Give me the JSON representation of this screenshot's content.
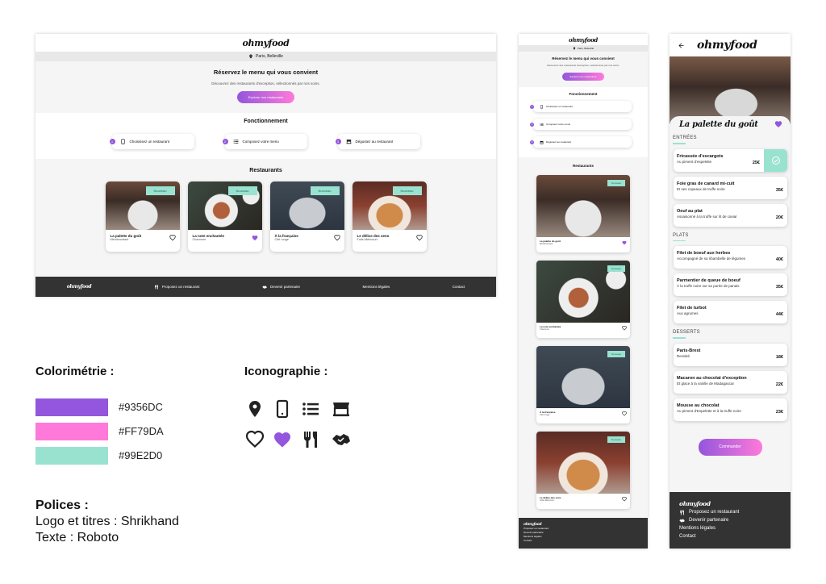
{
  "brand": "ohmyfood",
  "location": "Paris, Belleville",
  "hero": {
    "title": "Réservez le menu qui vous convient",
    "subtitle": "Découvrez des restaurants d'exception, sélectionnés par nos soins.",
    "cta": "Explorer nos restaurants"
  },
  "how": {
    "title": "Fonctionnement",
    "steps": [
      {
        "num": "1",
        "icon": "phone-icon",
        "label": "Choisissez un restaurant"
      },
      {
        "num": "2",
        "icon": "list-icon",
        "label": "Composez votre menu"
      },
      {
        "num": "3",
        "icon": "store-icon",
        "label": "Dégustez au restaurant"
      }
    ]
  },
  "restaurants": {
    "title": "Restaurants",
    "badge": "Nouveau",
    "items": [
      {
        "name": "La palette du goût",
        "area": "Ménilmontant",
        "liked": false
      },
      {
        "name": "La note enchantée",
        "area": "Charonne",
        "liked": true
      },
      {
        "name": "À la française",
        "area": "Cité rouge",
        "liked": false
      },
      {
        "name": "Le délice des sens",
        "area": "Folie-Méricourt",
        "liked": false
      }
    ]
  },
  "footer": {
    "propose": "Proposez un restaurant",
    "partner": "Devenir partenaire",
    "legal": "Mentions légales",
    "contact": "Contact"
  },
  "menu_page": {
    "restaurant": "La palette du goût",
    "sections": [
      {
        "title": "ENTRÉES",
        "dishes": [
          {
            "name": "Fricassée d'escargots",
            "desc": "Au piment d'espelette",
            "price": "25€",
            "selected": true
          },
          {
            "name": "Foie gras de canard mi-cuit",
            "desc": "Et ses copeaux de truffe noire",
            "price": "35€"
          },
          {
            "name": "Oeuf au plat",
            "desc": "Assaisonné à la truffe sur lit de caviar",
            "price": "20€"
          }
        ]
      },
      {
        "title": "PLATS",
        "dishes": [
          {
            "name": "Filet de boeuf aux herbes",
            "desc": "Accompagné de sa ribambelle de légumes",
            "price": "40€"
          },
          {
            "name": "Parmentier de queue de boeuf",
            "desc": "À la truffe noire sur sa purée de panais",
            "price": "35€"
          },
          {
            "name": "Filet de turbot",
            "desc": "Aux agrumes",
            "price": "44€"
          }
        ]
      },
      {
        "title": "DESSERTS",
        "dishes": [
          {
            "name": "Paris-Brest",
            "desc": "Revisité",
            "price": "18€"
          },
          {
            "name": "Macaron au chocolat d'exception",
            "desc": "Et glace à la vanille de Madagascar",
            "price": "22€"
          },
          {
            "name": "Mousse au chocolat",
            "desc": "Au piment d'Espelette et à la truffe noire",
            "price": "23€"
          }
        ]
      }
    ],
    "order": "Commander"
  },
  "styleguide": {
    "colors_title": "Colorimétrie :",
    "colors": [
      {
        "hex": "#9356DC"
      },
      {
        "hex": "#FF79DA"
      },
      {
        "hex": "#99E2D0"
      }
    ],
    "icons_title": "Iconographie :",
    "icons": [
      "location-icon",
      "mobile-icon",
      "list-icon",
      "store-icon",
      "heart-outline-icon",
      "heart-filled-icon",
      "utensils-icon",
      "handshake-icon"
    ],
    "fonts_title": "Polices :",
    "fonts_logo": "Logo et titres : Shrikhand",
    "fonts_text": "Texte : Roboto"
  }
}
